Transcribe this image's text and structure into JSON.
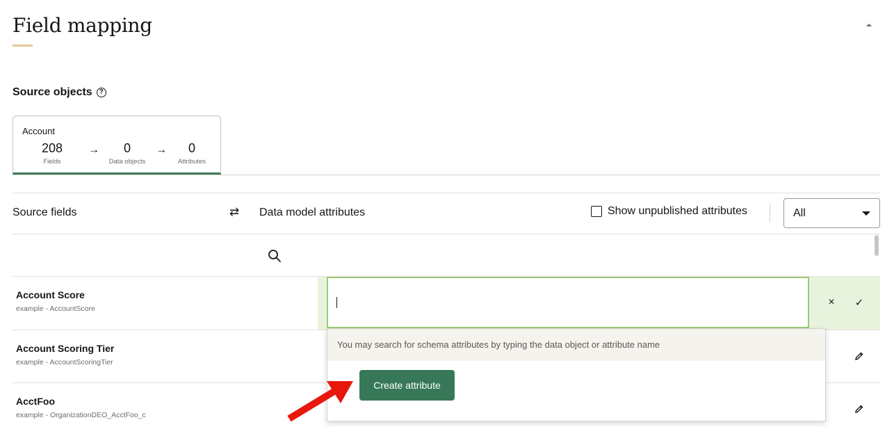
{
  "header": {
    "title": "Field mapping"
  },
  "source_objects": {
    "label": "Source objects",
    "help_icon": "?",
    "card": {
      "title": "Account",
      "fields_count": "208",
      "fields_label": "Fields",
      "data_objects_count": "0",
      "data_objects_label": "Data objects",
      "attributes_count": "0",
      "attributes_label": "Attributes",
      "arrow": "→"
    }
  },
  "mapping_header": {
    "source_fields": "Source fields",
    "swap_icon": "⇄",
    "data_model_attributes": "Data model attributes",
    "show_unpublished": "Show unpublished attributes",
    "filter_value": "All"
  },
  "rows": [
    {
      "name": "Account Score",
      "example": "example - AccountScore"
    },
    {
      "name": "Account Scoring Tier",
      "example": "example - AccountScoringTier"
    },
    {
      "name": "AcctFoo",
      "example": "example - OrganizationDEO_AcctFoo_c"
    }
  ],
  "attribute_search": {
    "value": "",
    "hint": "You may search for schema attributes by typing the data object or attribute name",
    "create_button": "Create attribute",
    "cancel_icon": "×",
    "confirm_icon": "✓"
  },
  "colors": {
    "accent_underline": "#e5c997",
    "tab_active": "#3e7a5b",
    "input_border": "#9ccb73",
    "row_active_bg": "#e8f3de",
    "create_button_bg": "#367858",
    "annotation_arrow": "#e8170c"
  }
}
